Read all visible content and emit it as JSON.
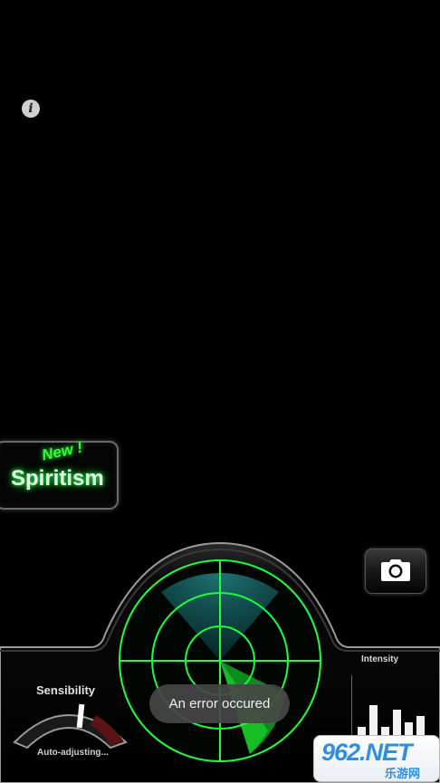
{
  "app": {
    "info_icon": "i"
  },
  "spiritism": {
    "badge": "New !",
    "label": "Spiritism",
    "accent_color": "#2dff3d"
  },
  "camera": {
    "icon": "camera-icon"
  },
  "radar": {
    "color": "#1cff3a"
  },
  "sensibility": {
    "title": "Sensibility",
    "status": "Auto-adjusting..."
  },
  "intensity": {
    "title": "Intensity",
    "levels": [
      0.35,
      0.85,
      0.35,
      0.75,
      0.45,
      0.6
    ]
  },
  "toast": {
    "message": "An error occured"
  },
  "watermark": {
    "main": "962.NET",
    "sub": "乐游网"
  }
}
